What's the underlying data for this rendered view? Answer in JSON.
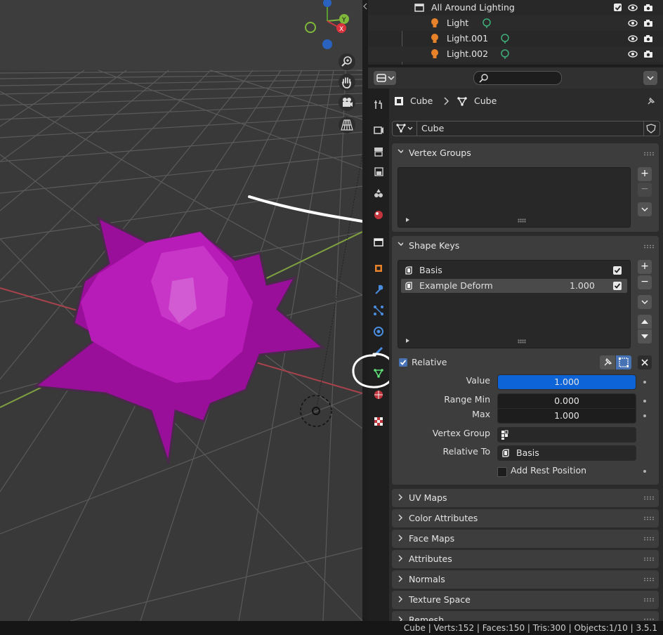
{
  "outliner": {
    "collection": "All Around Lighting",
    "items": [
      {
        "label": "Light"
      },
      {
        "label": "Light.001"
      },
      {
        "label": "Light.002"
      }
    ]
  },
  "header": {
    "breadcrumb_object": "Cube",
    "breadcrumb_data": "Cube",
    "mesh_name": "Cube"
  },
  "vertex_groups": {
    "title": "Vertex Groups"
  },
  "shape_keys": {
    "title": "Shape Keys",
    "keys": [
      {
        "name": "Basis",
        "value": "",
        "enabled": true
      },
      {
        "name": "Example Deform",
        "value": "1.000",
        "enabled": true
      }
    ],
    "relative_label": "Relative",
    "value_label": "Value",
    "value": "1.000",
    "value_fill": 1.0,
    "range_min_label": "Range Min",
    "range_min": "0.000",
    "max_label": "Max",
    "max": "1.000",
    "vertex_group_label": "Vertex Group",
    "vertex_group": "",
    "relative_to_label": "Relative To",
    "relative_to": "Basis",
    "add_rest_label": "Add Rest Position"
  },
  "collapsed_panels": [
    "UV Maps",
    "Color Attributes",
    "Face Maps",
    "Attributes",
    "Normals",
    "Texture Space",
    "Remesh"
  ],
  "status": {
    "text": "Cube | Verts:152 | Faces:150 | Tris:300 | Objects:1/10 | 3.5.1"
  },
  "colors": {
    "accent": "#4772b3",
    "slider": "#0c64d6",
    "mesh": "#b300b3",
    "mesh_tab": "#5fe07a"
  }
}
